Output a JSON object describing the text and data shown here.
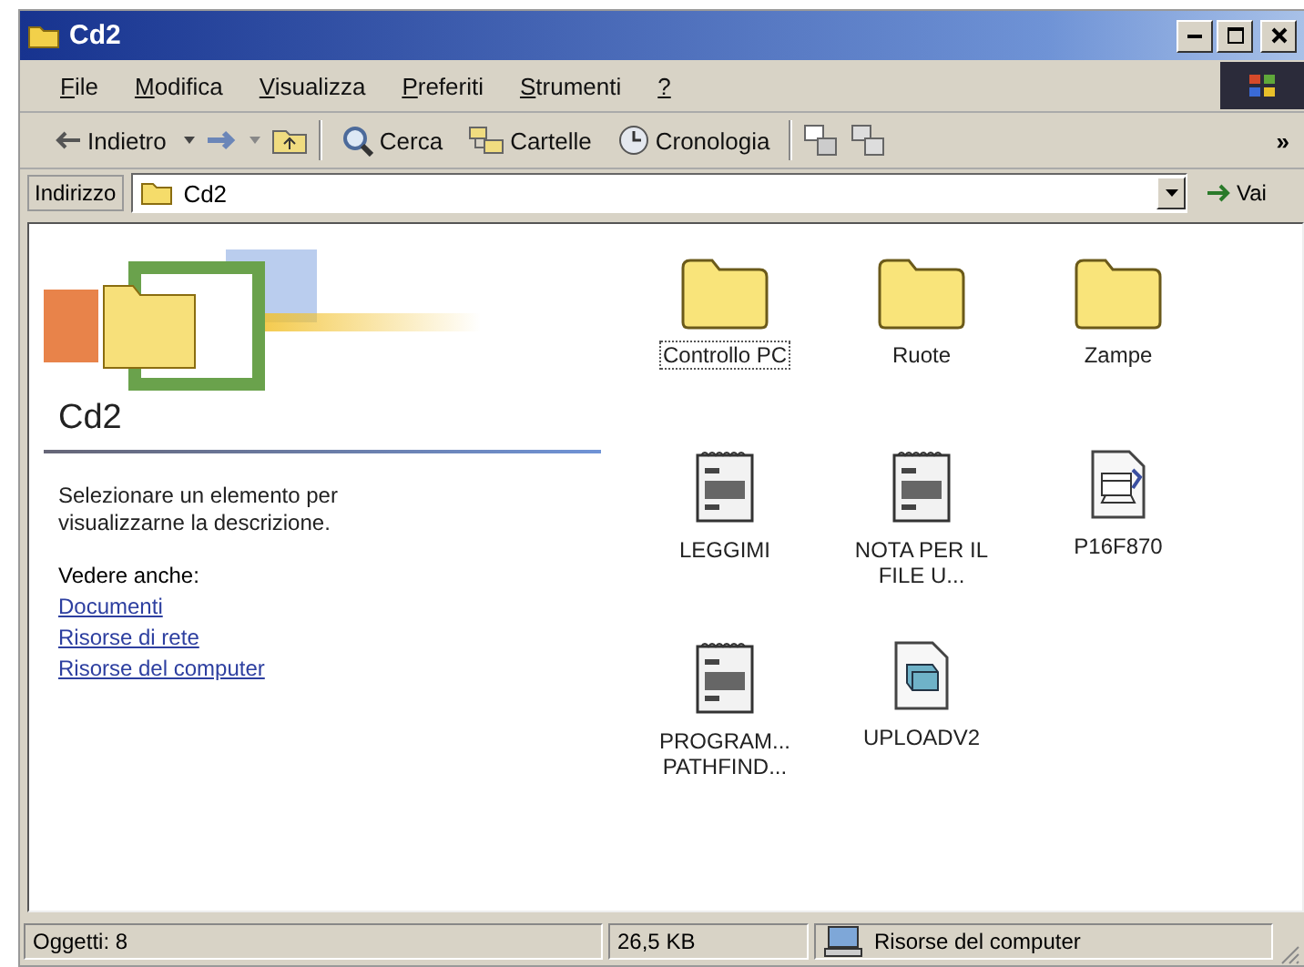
{
  "window": {
    "title": "Cd2"
  },
  "menu": [
    "File",
    "Modifica",
    "Visualizza",
    "Preferiti",
    "Strumenti",
    "?"
  ],
  "toolbar": {
    "back": "Indietro",
    "search": "Cerca",
    "folders": "Cartelle",
    "history": "Cronologia",
    "more": "»"
  },
  "address": {
    "label": "Indirizzo",
    "value": "Cd2",
    "go": "Vai"
  },
  "info_panel": {
    "title": "Cd2",
    "description": "Selezionare un elemento per visualizzarne la descrizione.",
    "see_also": "Vedere anche:",
    "links": [
      "Documenti",
      "Risorse di rete",
      "Risorse del computer"
    ]
  },
  "items": [
    {
      "kind": "folder",
      "label": "Controllo PC",
      "selected": true
    },
    {
      "kind": "folder",
      "label": "Ruote",
      "selected": false
    },
    {
      "kind": "folder",
      "label": "Zampe",
      "selected": false
    },
    {
      "kind": "text",
      "label": "LEGGIMI",
      "selected": false
    },
    {
      "kind": "text",
      "label": "NOTA PER IL FILE U...",
      "selected": false
    },
    {
      "kind": "document",
      "label": "P16F870",
      "selected": false
    },
    {
      "kind": "text",
      "label": "PROGRAM... PATHFIND...",
      "selected": false
    },
    {
      "kind": "program",
      "label": "UPLOADV2",
      "selected": false
    }
  ],
  "status_bar": {
    "objects": "Oggetti: 8",
    "size": "26,5 KB",
    "zone": "Risorse del computer"
  }
}
